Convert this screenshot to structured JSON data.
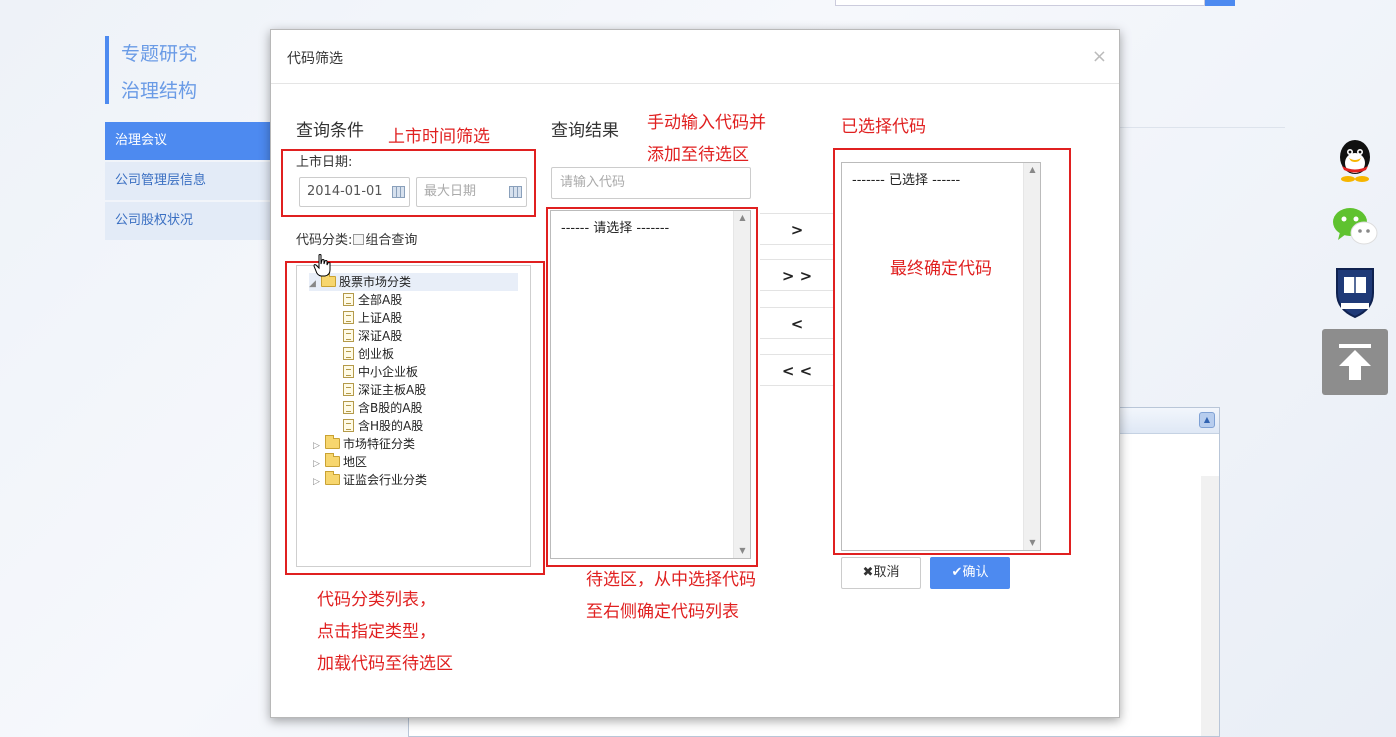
{
  "background": {
    "left_title": [
      "专题研究",
      "治理结构"
    ],
    "left_menu": [
      {
        "label": "治理会议",
        "active": true
      },
      {
        "label": "公司管理层信息",
        "active": false
      },
      {
        "label": "公司股权状况",
        "active": false
      }
    ],
    "side_icons": [
      "qq-icon",
      "wechat-icon",
      "university-shield-icon",
      "back-to-top-icon"
    ]
  },
  "modal": {
    "title": "代码筛选",
    "close": "×",
    "query_section": {
      "title": "查询条件",
      "listing_date_label": "上市日期:",
      "start_date_value": "2014-01-01",
      "end_date_placeholder": "最大日期",
      "code_category_label": "代码分类:",
      "combined_query_label": "组合查询"
    },
    "tree": [
      {
        "label": "股票市场分类",
        "type": "folder",
        "expanded": true,
        "level": 0,
        "selected": true
      },
      {
        "label": "全部A股",
        "type": "doc",
        "level": 1
      },
      {
        "label": "上证A股",
        "type": "doc",
        "level": 1
      },
      {
        "label": "深证A股",
        "type": "doc",
        "level": 1
      },
      {
        "label": "创业板",
        "type": "doc",
        "level": 1
      },
      {
        "label": "中小企业板",
        "type": "doc",
        "level": 1
      },
      {
        "label": "深证主板A股",
        "type": "doc",
        "level": 1
      },
      {
        "label": "含B股的A股",
        "type": "doc",
        "level": 1
      },
      {
        "label": "含H股的A股",
        "type": "doc",
        "level": 1
      },
      {
        "label": "市场特征分类",
        "type": "folder",
        "expanded": false,
        "level": 0
      },
      {
        "label": "地区",
        "type": "folder",
        "expanded": false,
        "level": 0
      },
      {
        "label": "证监会行业分类",
        "type": "folder",
        "expanded": false,
        "level": 0
      }
    ],
    "result_section": {
      "title": "查询结果",
      "code_input_placeholder": "请输入代码",
      "list_placeholder": "------ 请选择 -------"
    },
    "move_buttons": [
      ">",
      "> >",
      "<",
      "< <"
    ],
    "selected_section": {
      "title": "已选择代码",
      "list_placeholder": "------- 已选择 ------"
    },
    "buttons": {
      "cancel": "✖取消",
      "confirm": "✔确认"
    },
    "annotations": {
      "date_filter": "上市时间筛选",
      "manual_input": [
        "手动输入代码并",
        "添加至待选区"
      ],
      "final_codes": "最终确定代码",
      "category_list": [
        "代码分类列表，",
        "点击指定类型，",
        "加载代码至待选区"
      ],
      "pending_area": [
        "待选区，从中选择代码",
        "至右侧确定代码列表"
      ]
    },
    "colors": {
      "accent": "#4d8af0",
      "annotation_red": "#e02020"
    }
  }
}
